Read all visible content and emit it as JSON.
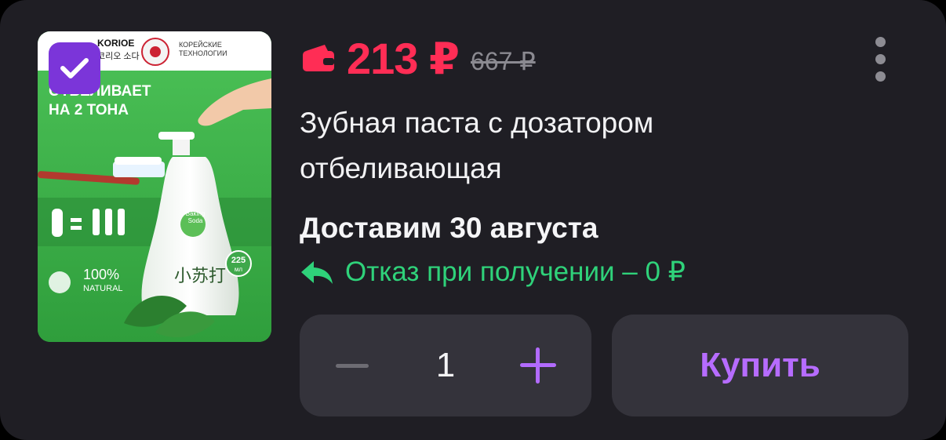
{
  "product": {
    "price": "213 ₽",
    "old_price": "667 ₽",
    "title": "Зубная паста с дозатором отбеливающая",
    "delivery": "Доставим 30 августа",
    "return_policy": "Отказ при получении – 0 ₽",
    "image": {
      "brand": "KORIOE",
      "brand_sub": "코리오 소다",
      "badge_text": "КОРЕЙСКИЕ ТЕХНОЛОГИИ",
      "headline_1": "ОТБЕЛИВАЕТ",
      "headline_2": "НА 2 ТОНА",
      "natural_pct": "100%",
      "natural_label": "NATURAL",
      "volume": "225",
      "volume_unit": "мл",
      "bottle_label": "小苏打",
      "bottle_sub": "Baking Soda"
    },
    "selected": true
  },
  "cart": {
    "quantity": "1",
    "buy_label": "Купить"
  },
  "colors": {
    "price": "#ff2d55",
    "return": "#2fd27a",
    "accent": "#b66cff",
    "checkbox": "#7b35d9",
    "card_bg": "#1f1e24"
  },
  "icons": [
    "wallet-icon",
    "more-vertical-icon",
    "return-arrow-icon",
    "check-icon",
    "minus-icon",
    "plus-icon"
  ]
}
